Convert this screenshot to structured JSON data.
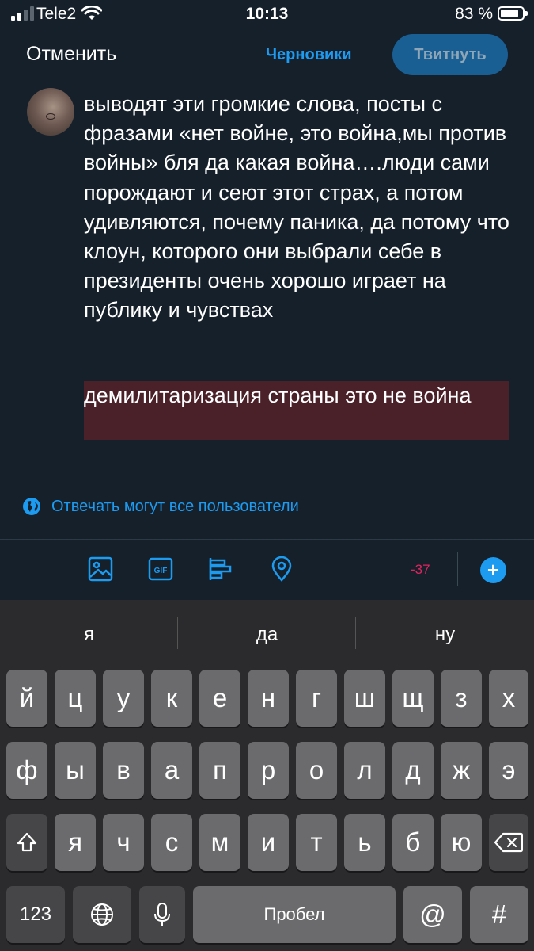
{
  "status": {
    "carrier": "Tele2",
    "time": "10:13",
    "battery_pct": "83 %"
  },
  "header": {
    "cancel_label": "Отменить",
    "drafts_label": "Черновики",
    "tweet_label": "Твитнуть"
  },
  "compose": {
    "text": "выводят эти громкие слова, посты с фразами «нет войне, это война,мы против войны» бля да какая война….люди сами порождают и сеют этот страх, а потом удивляются, почему паника, да потому что клоун, которого они выбрали себе в президенты очень хорошо играет на публику и чувствах",
    "over_limit_text": "демилитаризация страны это не война"
  },
  "reply_setting": {
    "label": "Отвечать могут все пользователи"
  },
  "toolbar": {
    "gif_label": "GIF",
    "char_counter": "-37",
    "plus_label": "+"
  },
  "keyboard": {
    "suggestions": [
      "я",
      "да",
      "ну"
    ],
    "row1": [
      "й",
      "ц",
      "у",
      "к",
      "е",
      "н",
      "г",
      "ш",
      "щ",
      "з",
      "х"
    ],
    "row2": [
      "ф",
      "ы",
      "в",
      "а",
      "п",
      "р",
      "о",
      "л",
      "д",
      "ж",
      "э"
    ],
    "row3": [
      "я",
      "ч",
      "с",
      "м",
      "и",
      "т",
      "ь",
      "б",
      "ю"
    ],
    "numbers_label": "123",
    "space_label": "Пробел",
    "at_label": "@",
    "hash_label": "#"
  },
  "colors": {
    "background": "#15202b",
    "accent": "#1d9bf0",
    "over_limit_highlight": "#4a2029",
    "counter_negative": "#e0245e"
  }
}
